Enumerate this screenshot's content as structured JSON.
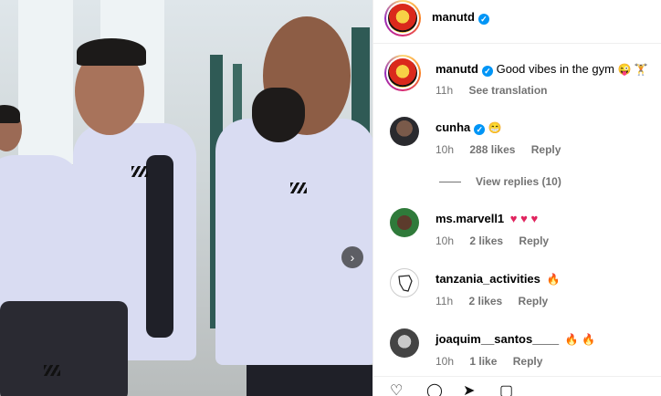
{
  "header": {
    "username": "manutd"
  },
  "caption": {
    "username": "manutd",
    "text": "Good vibes in the gym",
    "emojis": "😜 🏋",
    "time": "11h",
    "translate": "See translation"
  },
  "comments": [
    {
      "username": "cunha",
      "verified": true,
      "text": "😁",
      "time": "10h",
      "likes": "288 likes",
      "reply": "Reply"
    },
    {
      "username": "ms.marvell1",
      "text": "♥ ♥ ♥",
      "time": "10h",
      "likes": "2 likes",
      "reply": "Reply"
    },
    {
      "username": "tanzania_activities",
      "text": "🔥",
      "time": "11h",
      "likes": "2 likes",
      "reply": "Reply"
    },
    {
      "username": "joaquim__santos____",
      "text": "🔥 🔥",
      "time": "10h",
      "likes": "1 like",
      "reply": "Reply"
    }
  ],
  "view_replies": "View replies (10)",
  "icons": {
    "next": "chevron-right-icon",
    "verified": "verified-badge-icon",
    "like": "heart-icon",
    "comment": "comment-icon",
    "share": "share-icon",
    "save": "bookmark-icon"
  },
  "colors": {
    "verified": "#0095f6",
    "muted": "#737373",
    "heart": "#e0245e",
    "brand_red": "#da291c"
  }
}
